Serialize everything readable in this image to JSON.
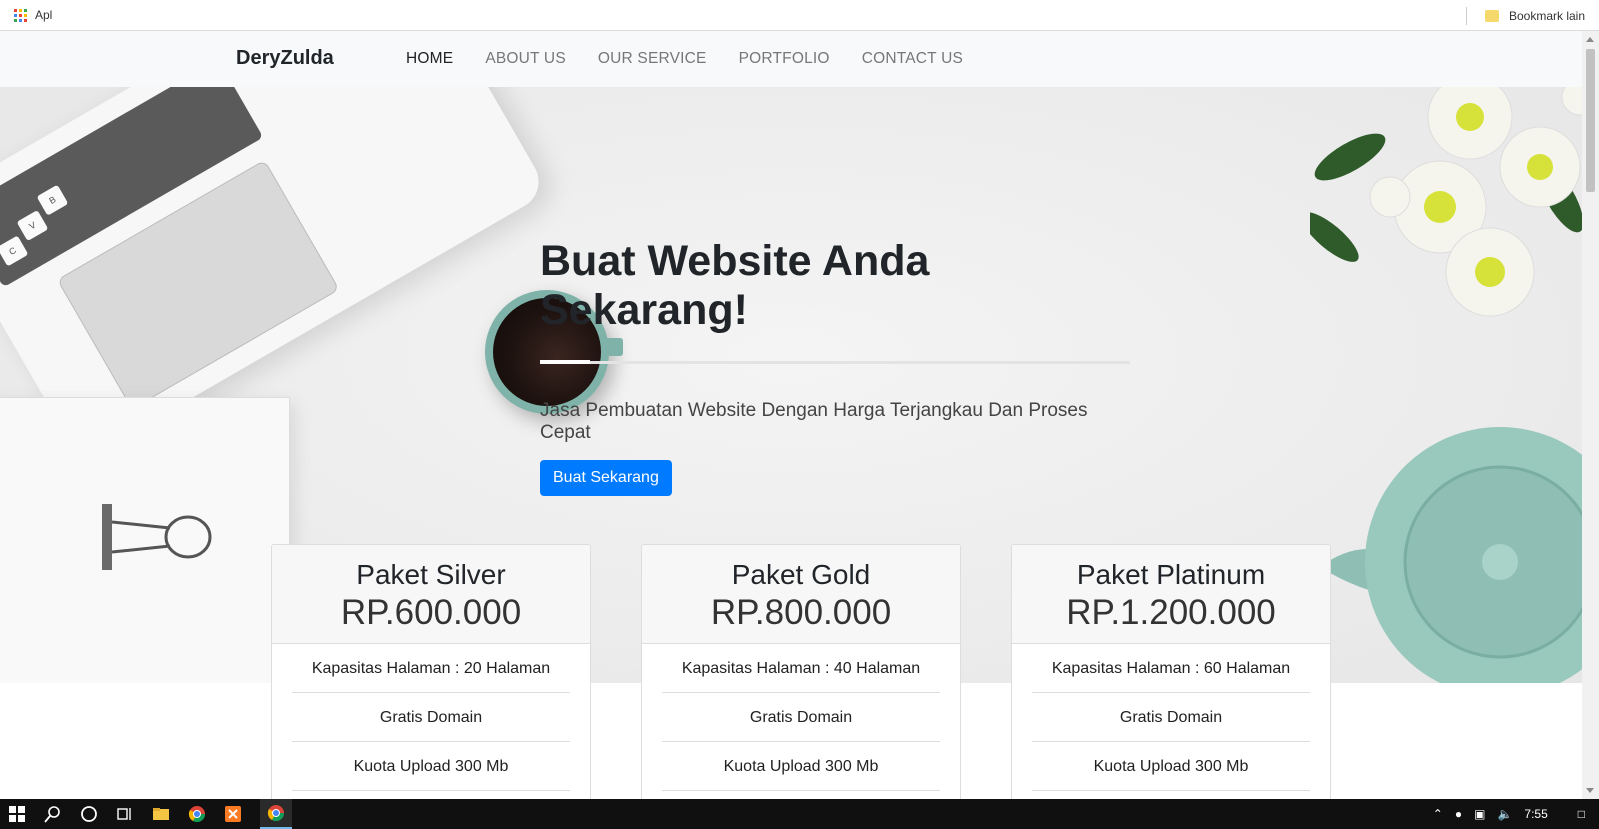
{
  "bookmarks_bar": {
    "apps_label": "Apl",
    "other_bookmarks_label": "Bookmark lain"
  },
  "navbar": {
    "brand": "DeryZulda",
    "items": [
      {
        "label": "HOME",
        "active": true
      },
      {
        "label": "ABOUT US",
        "active": false
      },
      {
        "label": "OUR SERVICE",
        "active": false
      },
      {
        "label": "PORTFOLIO",
        "active": false
      },
      {
        "label": "CONTACT US",
        "active": false
      }
    ]
  },
  "hero": {
    "title": "Buat Website Anda Sekarang!",
    "subtitle": "Jasa Pembuatan Website Dengan Harga Terjangkau Dan Proses Cepat",
    "button_label": "Buat Sekarang"
  },
  "pricing": [
    {
      "name": "Paket Silver",
      "price": "RP.600.000",
      "features": [
        "Kapasitas Halaman : 20 Halaman",
        "Gratis Domain",
        "Kuota Upload 300 Mb"
      ]
    },
    {
      "name": "Paket Gold",
      "price": "RP.800.000",
      "features": [
        "Kapasitas Halaman : 40 Halaman",
        "Gratis Domain",
        "Kuota Upload 300 Mb"
      ]
    },
    {
      "name": "Paket Platinum",
      "price": "RP.1.200.000",
      "features": [
        "Kapasitas Halaman : 60 Halaman",
        "Gratis Domain",
        "Kuota Upload 300 Mb"
      ]
    }
  ],
  "taskbar": {
    "clock": "7:55",
    "icons": [
      "windows-start-icon",
      "search-icon",
      "cortana-icon",
      "task-view-icon",
      "file-explorer-icon",
      "chrome-icon",
      "xampp-icon",
      "chrome-icon"
    ]
  },
  "colors": {
    "primary_button": "#007bff",
    "navbar_bg": "#f8f9fa",
    "taskbar_bg": "#101010"
  }
}
